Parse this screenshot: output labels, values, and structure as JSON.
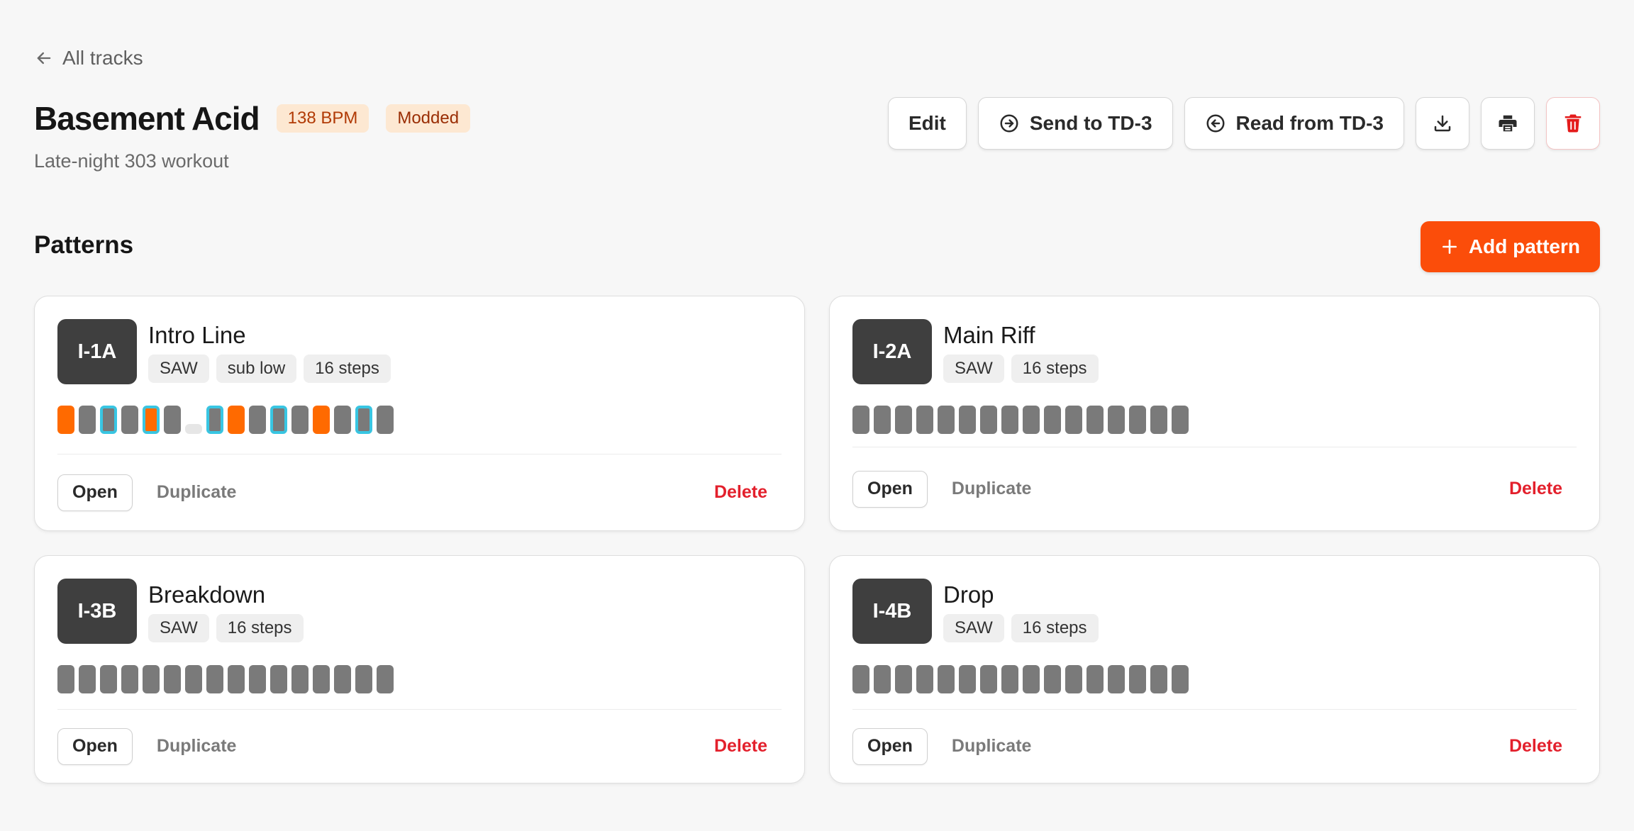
{
  "nav": {
    "back_label": "All tracks"
  },
  "track": {
    "title": "Basement Acid",
    "bpm_badge": "138 BPM",
    "status_badge": "Modded",
    "subtitle": "Late-night 303 workout"
  },
  "toolbar": {
    "edit_label": "Edit",
    "send_label": "Send to TD-3",
    "read_label": "Read from TD-3",
    "download_icon": "download-icon",
    "print_icon": "printer-icon",
    "delete_icon": "trash-icon"
  },
  "patterns_section": {
    "title": "Patterns",
    "add_label": "Add pattern"
  },
  "patterns": [
    {
      "slot": "I-1A",
      "name": "Intro Line",
      "tags": [
        "SAW",
        "sub low",
        "16 steps"
      ],
      "steps": [
        "acc",
        "note",
        "slide",
        "note",
        "acc-slide",
        "note",
        "rest",
        "slide",
        "acc",
        "note",
        "slide",
        "note",
        "acc",
        "note",
        "slide",
        "note"
      ],
      "open_label": "Open",
      "duplicate_label": "Duplicate",
      "delete_label": "Delete"
    },
    {
      "slot": "I-2A",
      "name": "Main Riff",
      "tags": [
        "SAW",
        "16 steps"
      ],
      "steps": [
        "note",
        "note",
        "note",
        "note",
        "note",
        "note",
        "note",
        "note",
        "note",
        "note",
        "note",
        "note",
        "note",
        "note",
        "note",
        "note"
      ],
      "open_label": "Open",
      "duplicate_label": "Duplicate",
      "delete_label": "Delete"
    },
    {
      "slot": "I-3B",
      "name": "Breakdown",
      "tags": [
        "SAW",
        "16 steps"
      ],
      "steps": [
        "note",
        "note",
        "note",
        "note",
        "note",
        "note",
        "note",
        "note",
        "note",
        "note",
        "note",
        "note",
        "note",
        "note",
        "note",
        "note"
      ],
      "open_label": "Open",
      "duplicate_label": "Duplicate",
      "delete_label": "Delete"
    },
    {
      "slot": "I-4B",
      "name": "Drop",
      "tags": [
        "SAW",
        "16 steps"
      ],
      "steps": [
        "note",
        "note",
        "note",
        "note",
        "note",
        "note",
        "note",
        "note",
        "note",
        "note",
        "note",
        "note",
        "note",
        "note",
        "note",
        "note"
      ],
      "open_label": "Open",
      "duplicate_label": "Duplicate",
      "delete_label": "Delete"
    }
  ],
  "colors": {
    "accent": "#fb4d0a",
    "accent_step": "#ff6a00",
    "slide_outline": "#38c6e3",
    "step": "#7a7a7a",
    "danger": "#e3202c"
  }
}
